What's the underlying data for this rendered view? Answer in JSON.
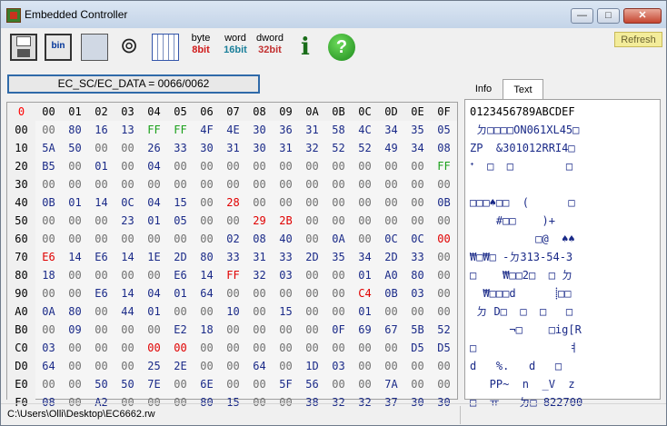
{
  "window": {
    "title": "Embedded Controller",
    "min_glyph": "—",
    "max_glyph": "□",
    "close_glyph": "✕"
  },
  "toolbar": {
    "bin_label": "bin",
    "byte_label": "byte",
    "byte_bits": "8bit",
    "word_label": "word",
    "word_bits": "16bit",
    "dword_label": "dword",
    "dword_bits": "32bit",
    "info_glyph": "i",
    "help_glyph": "?",
    "refresh_label": "Refresh"
  },
  "register_field": "EC_SC/EC_DATA = 0066/0062",
  "hex_table": {
    "corner": "0",
    "col_headers": [
      "00",
      "01",
      "02",
      "03",
      "04",
      "05",
      "06",
      "07",
      "08",
      "09",
      "0A",
      "0B",
      "0C",
      "0D",
      "0E",
      "0F"
    ],
    "row_headers": [
      "00",
      "10",
      "20",
      "30",
      "40",
      "50",
      "60",
      "70",
      "80",
      "90",
      "A0",
      "B0",
      "C0",
      "D0",
      "E0",
      "F0"
    ],
    "rows": [
      [
        "00",
        "80",
        "16",
        "13",
        "FF",
        "FF",
        "4F",
        "4E",
        "30",
        "36",
        "31",
        "58",
        "4C",
        "34",
        "35",
        "05"
      ],
      [
        "5A",
        "50",
        "00",
        "00",
        "26",
        "33",
        "30",
        "31",
        "30",
        "31",
        "32",
        "52",
        "52",
        "49",
        "34",
        "08"
      ],
      [
        "B5",
        "00",
        "01",
        "00",
        "04",
        "00",
        "00",
        "00",
        "00",
        "00",
        "00",
        "00",
        "00",
        "00",
        "00",
        "FF"
      ],
      [
        "00",
        "00",
        "00",
        "00",
        "00",
        "00",
        "00",
        "00",
        "00",
        "00",
        "00",
        "00",
        "00",
        "00",
        "00",
        "00"
      ],
      [
        "0B",
        "01",
        "14",
        "0C",
        "04",
        "15",
        "00",
        "28",
        "00",
        "00",
        "00",
        "00",
        "00",
        "00",
        "00",
        "0B"
      ],
      [
        "00",
        "00",
        "00",
        "23",
        "01",
        "05",
        "00",
        "00",
        "29",
        "2B",
        "00",
        "00",
        "00",
        "00",
        "00",
        "00"
      ],
      [
        "00",
        "00",
        "00",
        "00",
        "00",
        "00",
        "00",
        "02",
        "08",
        "40",
        "00",
        "0A",
        "00",
        "0C",
        "0C",
        "00"
      ],
      [
        "E6",
        "14",
        "E6",
        "14",
        "1E",
        "2D",
        "80",
        "33",
        "31",
        "33",
        "2D",
        "35",
        "34",
        "2D",
        "33",
        "00"
      ],
      [
        "18",
        "00",
        "00",
        "00",
        "00",
        "E6",
        "14",
        "FF",
        "32",
        "03",
        "00",
        "00",
        "01",
        "A0",
        "80",
        "00"
      ],
      [
        "00",
        "00",
        "E6",
        "14",
        "04",
        "01",
        "64",
        "00",
        "00",
        "00",
        "00",
        "00",
        "C4",
        "0B",
        "03",
        "00"
      ],
      [
        "0A",
        "80",
        "00",
        "44",
        "01",
        "00",
        "00",
        "10",
        "00",
        "15",
        "00",
        "00",
        "01",
        "00",
        "00",
        "00"
      ],
      [
        "00",
        "09",
        "00",
        "00",
        "00",
        "E2",
        "18",
        "00",
        "00",
        "00",
        "00",
        "0F",
        "69",
        "67",
        "5B",
        "52"
      ],
      [
        "03",
        "00",
        "00",
        "00",
        "00",
        "00",
        "00",
        "00",
        "00",
        "00",
        "00",
        "00",
        "00",
        "00",
        "D5",
        "D5"
      ],
      [
        "64",
        "00",
        "00",
        "00",
        "25",
        "2E",
        "00",
        "00",
        "64",
        "00",
        "1D",
        "03",
        "00",
        "00",
        "00",
        "00"
      ],
      [
        "00",
        "00",
        "50",
        "50",
        "7E",
        "00",
        "6E",
        "00",
        "00",
        "5F",
        "56",
        "00",
        "00",
        "7A",
        "00",
        "00"
      ],
      [
        "08",
        "00",
        "A2",
        "00",
        "00",
        "00",
        "80",
        "15",
        "00",
        "00",
        "38",
        "32",
        "32",
        "37",
        "30",
        "30"
      ]
    ],
    "colors": [
      [
        "g",
        "n",
        "n",
        "n",
        "G",
        "G",
        "n",
        "n",
        "n",
        "n",
        "n",
        "n",
        "n",
        "n",
        "n",
        "n"
      ],
      [
        "n",
        "n",
        "g",
        "g",
        "n",
        "n",
        "n",
        "n",
        "n",
        "n",
        "n",
        "n",
        "n",
        "n",
        "n",
        "n"
      ],
      [
        "n",
        "g",
        "n",
        "g",
        "n",
        "g",
        "g",
        "g",
        "g",
        "g",
        "g",
        "g",
        "g",
        "g",
        "g",
        "G"
      ],
      [
        "g",
        "g",
        "g",
        "g",
        "g",
        "g",
        "g",
        "g",
        "g",
        "g",
        "g",
        "g",
        "g",
        "g",
        "g",
        "g"
      ],
      [
        "n",
        "n",
        "n",
        "n",
        "n",
        "n",
        "g",
        "r",
        "g",
        "g",
        "g",
        "g",
        "g",
        "g",
        "g",
        "n"
      ],
      [
        "g",
        "g",
        "g",
        "n",
        "n",
        "n",
        "g",
        "g",
        "r",
        "r",
        "g",
        "g",
        "g",
        "g",
        "g",
        "g"
      ],
      [
        "g",
        "g",
        "g",
        "g",
        "g",
        "g",
        "g",
        "n",
        "n",
        "n",
        "g",
        "n",
        "g",
        "n",
        "n",
        "r"
      ],
      [
        "r",
        "n",
        "n",
        "n",
        "n",
        "n",
        "n",
        "n",
        "n",
        "n",
        "n",
        "n",
        "n",
        "n",
        "n",
        "g"
      ],
      [
        "n",
        "g",
        "g",
        "g",
        "g",
        "n",
        "n",
        "r",
        "n",
        "n",
        "g",
        "g",
        "n",
        "n",
        "n",
        "g"
      ],
      [
        "g",
        "g",
        "n",
        "n",
        "n",
        "n",
        "n",
        "g",
        "g",
        "g",
        "g",
        "g",
        "r",
        "n",
        "n",
        "g"
      ],
      [
        "n",
        "n",
        "g",
        "n",
        "n",
        "g",
        "g",
        "n",
        "g",
        "n",
        "g",
        "g",
        "n",
        "g",
        "g",
        "g"
      ],
      [
        "g",
        "n",
        "g",
        "g",
        "g",
        "n",
        "n",
        "g",
        "g",
        "g",
        "g",
        "n",
        "n",
        "n",
        "n",
        "n"
      ],
      [
        "n",
        "g",
        "g",
        "g",
        "r",
        "r",
        "g",
        "g",
        "g",
        "g",
        "g",
        "g",
        "g",
        "g",
        "n",
        "n"
      ],
      [
        "n",
        "g",
        "g",
        "g",
        "n",
        "n",
        "g",
        "g",
        "n",
        "g",
        "n",
        "n",
        "g",
        "g",
        "g",
        "g"
      ],
      [
        "g",
        "g",
        "n",
        "n",
        "n",
        "g",
        "n",
        "g",
        "g",
        "n",
        "n",
        "g",
        "g",
        "n",
        "g",
        "g"
      ],
      [
        "n",
        "g",
        "n",
        "g",
        "g",
        "g",
        "n",
        "n",
        "g",
        "g",
        "n",
        "n",
        "n",
        "n",
        "n",
        "n"
      ]
    ]
  },
  "tabs": {
    "info": "Info",
    "text": "Text"
  },
  "text_panel": {
    "header": "0123456789ABCDEF",
    "lines": [
      " ㄉ□□□□ON061XL45□",
      "ZP  &301012RRI4□",
      "ᐩ  □  □        □",
      "",
      "□□□♠□□  (      □",
      "    #□□    )+   ",
      "          □@  ♠♠",
      "₩□₩□ -ㄉ313-54-3",
      "□    ₩□□2□  □ ㄉ",
      "  ₩□□□d      ⸽□□",
      " ㄉ D□  □  □   □",
      "      ¬□    □ig[R",
      "□              ㅕ",
      "d   %.   d   □  ",
      "   PP~  n  _V  z",
      "□  ㅠ   ㄉ□ 822700"
    ]
  },
  "status": {
    "path": "C:\\Users\\Olli\\Desktop\\EC6662.rw"
  }
}
